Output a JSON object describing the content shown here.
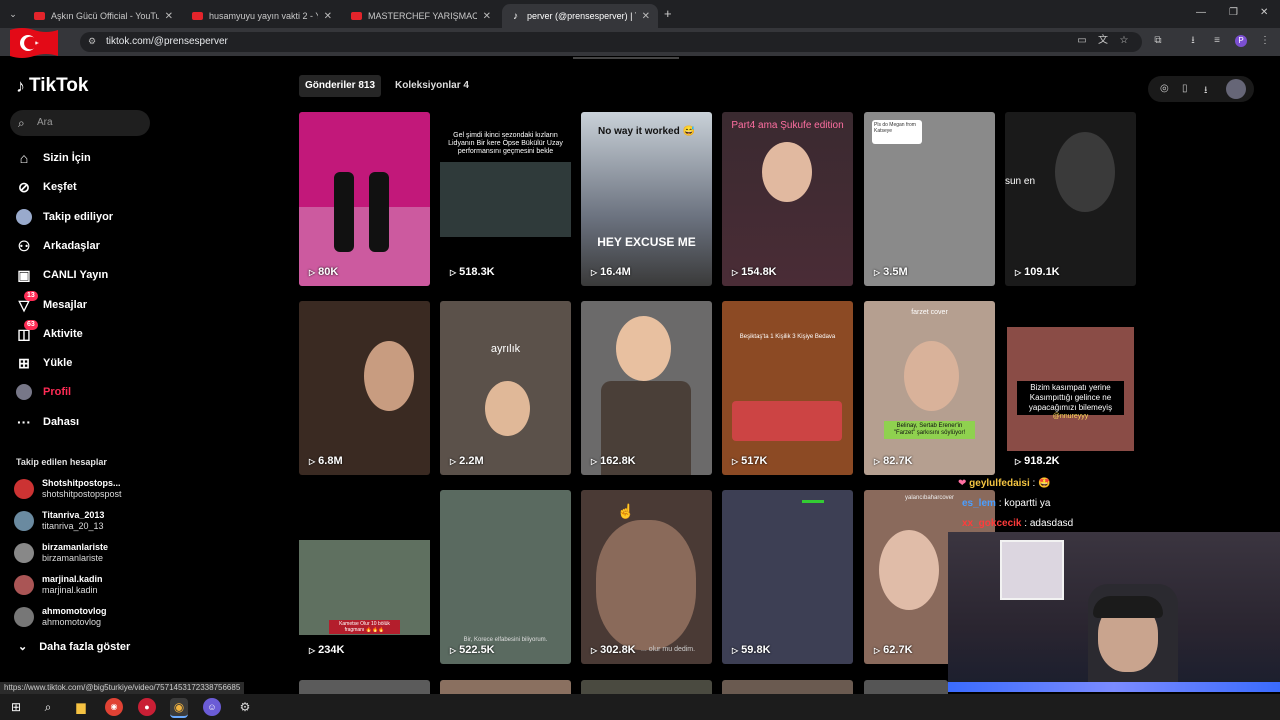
{
  "browser": {
    "tabs": [
      {
        "title": "Aşkın Gücü Official - YouTube",
        "type": "youtube"
      },
      {
        "title": "husamyuyu yayın vakti 2 - YouTube",
        "type": "youtube"
      },
      {
        "title": "MASTERCHEF YARIŞMACILARIN",
        "type": "youtube"
      },
      {
        "title": "perver (@prensesperver) | TikTok",
        "type": "tiktok"
      }
    ],
    "url": "tiktok.com/@prensesperver",
    "status_url": "https://www.tiktok.com/@big5turkiye/video/7571453172338756685"
  },
  "sidebar": {
    "logo": "TikTok",
    "search_placeholder": "Ara",
    "nav": [
      {
        "label": "Sizin İçin",
        "icon": "home-icon"
      },
      {
        "label": "Keşfet",
        "icon": "compass-icon"
      },
      {
        "label": "Takip ediliyor",
        "icon": "following-icon"
      },
      {
        "label": "Arkadaşlar",
        "icon": "friends-icon"
      },
      {
        "label": "CANLI Yayın",
        "icon": "live-icon"
      },
      {
        "label": "Mesajlar",
        "icon": "messages-icon",
        "badge": "13"
      },
      {
        "label": "Aktivite",
        "icon": "activity-icon",
        "badge": "63"
      },
      {
        "label": "Yükle",
        "icon": "upload-icon"
      },
      {
        "label": "Profil",
        "icon": "profile-icon"
      },
      {
        "label": "Dahası",
        "icon": "more-icon"
      }
    ],
    "following_header": "Takip edilen hesaplar",
    "accounts": [
      {
        "name": "Shotshitpostops...",
        "username": "shotshitpostopspost"
      },
      {
        "name": "Titanriva_2013",
        "username": "titanriva_20_13"
      },
      {
        "name": "birzamanlariste",
        "username": "birzamanlariste"
      },
      {
        "name": "marjinal.kadin",
        "username": "marjinal.kadin"
      },
      {
        "name": "ahmomotovlog",
        "username": "ahmomotovlog"
      }
    ],
    "show_more": "Daha fazla göster"
  },
  "profile_tabs": {
    "posts": "Gönderiler 813",
    "collections": "Koleksiyonlar 4"
  },
  "videos": [
    {
      "views": "80K",
      "bg": "#c2187a",
      "caption": ""
    },
    {
      "views": "518.3K",
      "bg": "#2f3a3a",
      "caption": "Gel şimdi ikinci sezondaki kızların Lidyanın Bir kere Öpse Bükülür Uzay performansını geçmesini bekle"
    },
    {
      "views": "16.4M",
      "bg": "#6c7380",
      "caption": "No way it worked 😅",
      "caption2": "HEY EXCUSE ME"
    },
    {
      "views": "154.8K",
      "bg": "#4a2c36",
      "caption": "Part4 ama Şukufe edition"
    },
    {
      "views": "3.5M",
      "bg": "#8a8a8a",
      "caption": "Pls do Megan from Katseye"
    },
    {
      "views": "109.1K",
      "bg": "#1a1a1a",
      "caption": "sun en"
    },
    {
      "views": "6.8M",
      "bg": "#3a2a22",
      "caption": ""
    },
    {
      "views": "2.2M",
      "bg": "#5b514a",
      "caption": "ayrılık"
    },
    {
      "views": "162.8K",
      "bg": "#6b6a6a",
      "caption": ""
    },
    {
      "views": "517K",
      "bg": "#8c4a24",
      "caption": "Beşiktaş'ta 1 Kişilik 3 Kişiye Bedava"
    },
    {
      "views": "82.7K",
      "bg": "#b59f90",
      "caption": "farzet cover",
      "caption2": "Belinay, Sertab Erener'in \"Farzet\" şarkısını söylüyor!"
    },
    {
      "views": "918.2K",
      "bg": "#8a4c46",
      "caption": "Bizim kasımpatı yerine Kasımpıttığı gelince ne yapacağımızı bilemeyiş",
      "caption2": "@nnureyyy"
    },
    {
      "views": "234K",
      "bg": "#5f7060",
      "caption": "Kametse Olur 10 bölük fragmanı 🔥🔥🔥"
    },
    {
      "views": "522.5K",
      "bg": "#5a6a60",
      "caption": "Bir, Korece elfabesini biliyorum."
    },
    {
      "views": "302.8K",
      "bg": "#4a3a35",
      "caption": "... olur mu dedim."
    },
    {
      "views": "59.8K",
      "bg": "#3d3f54",
      "caption": ""
    },
    {
      "views": "62.7K",
      "bg": "#8a6a5c",
      "caption": "yalancıbaharcover"
    }
  ],
  "chat": [
    {
      "user": "geylulfedaisi",
      "text": "🤩",
      "color": "#f4c542"
    },
    {
      "user": "es_lem",
      "text": "kopartti ya",
      "color": "#4a9eff"
    },
    {
      "user": "xx_gokcecik",
      "text": "adasdasd",
      "color": "#ff3b3b"
    }
  ],
  "colors": {
    "accent": "#fe2c55"
  }
}
